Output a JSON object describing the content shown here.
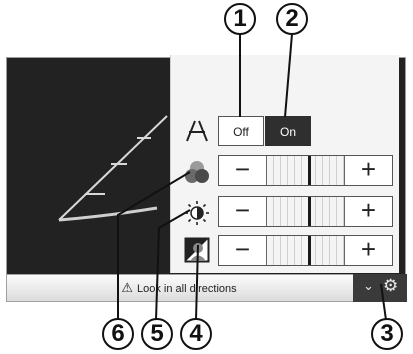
{
  "callouts": {
    "c1": "1",
    "c2": "2",
    "c3": "3",
    "c4": "4",
    "c5": "5",
    "c6": "6"
  },
  "grid_toggle": {
    "icon": "guideline-icon",
    "off_label": "Off",
    "on_label": "On",
    "selected": "On"
  },
  "colour_row": {
    "icon": "colour-icon",
    "minus": "−",
    "plus": "+",
    "level": 0.55
  },
  "brightness_row": {
    "icon": "brightness-icon",
    "minus": "−",
    "plus": "+",
    "level": 0.55
  },
  "contrast_row": {
    "icon": "contrast-icon",
    "minus": "−",
    "plus": "+",
    "level": 0.55
  },
  "status_bar": {
    "warning_icon": "warning-icon",
    "message": "Look in all directions"
  },
  "menu_button": {
    "chevron_icon": "chevron-down-icon",
    "gear_icon": "gear-icon"
  },
  "colors": {
    "screen_bg": "#222222",
    "panel_bg": "#f4f4f4",
    "on_bg": "#2f2f2f"
  }
}
